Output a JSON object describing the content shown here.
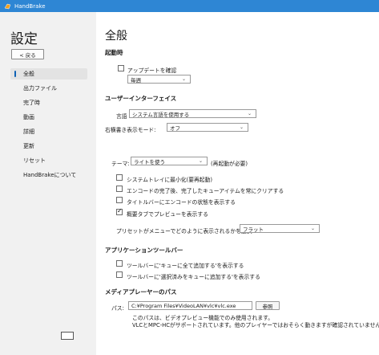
{
  "window": {
    "title": "HandBrake"
  },
  "sidebar": {
    "title": "設定",
    "back_label": "< 戻る",
    "items": [
      {
        "label": "全般",
        "active": true
      },
      {
        "label": "出力ファイル"
      },
      {
        "label": "完了時"
      },
      {
        "label": "動画"
      },
      {
        "label": "詳細"
      },
      {
        "label": "更新"
      },
      {
        "label": "リセット"
      },
      {
        "label": "HandBrakeについて"
      }
    ]
  },
  "main": {
    "title": "全般",
    "startup": {
      "heading": "起動時",
      "check_updates_label": "アップデートを確認",
      "check_updates_checked": false,
      "frequency_value": "毎週"
    },
    "ui": {
      "heading": "ユーザーインターフェイス",
      "language_label": "言語",
      "language_value": "システム言語を使用する",
      "rtl_label": "右横書き表示モード:",
      "rtl_value": "オフ",
      "theme_label": "テーマ:",
      "theme_value": "ライトを使う",
      "theme_note": "(再起動が必要)",
      "options": [
        {
          "label": "システムトレイに最小化(要再起動)",
          "checked": false
        },
        {
          "label": "エンコードの完了後、完了したキューアイテムを常にクリアする",
          "checked": false
        },
        {
          "label": "タイトルバーにエンコードの状態を表示する",
          "checked": false
        },
        {
          "label": "概要タブでプレビューを表示する",
          "checked": true
        }
      ],
      "preset_display_label": "プリセットがメニューでどのように表示されるかを選択:",
      "preset_display_value": "フラット"
    },
    "toolbar": {
      "heading": "アプリケーションツールバー",
      "options": [
        {
          "label": "ツールバーに'キューに全て追加する'を表示する",
          "checked": false
        },
        {
          "label": "ツールバーに'選択済みをキューに追加する'を表示する",
          "checked": false
        }
      ]
    },
    "media_player": {
      "heading": "メディアプレーヤーのパス",
      "path_label": "パス:",
      "path_value": "C:¥Program Files¥VideoLAN¥vlc¥vlc.exe",
      "browse_label": "参照",
      "note1": "このパスは、ビデオプレビュー機能でのみ使用されます。",
      "note2": "VLCとMPC-HCがサポートされています。他のプレイヤーではおそらく動きますが確認されていません。"
    }
  },
  "colors": {
    "titlebar": "#2e86d4",
    "accent": "#0f62b5"
  }
}
